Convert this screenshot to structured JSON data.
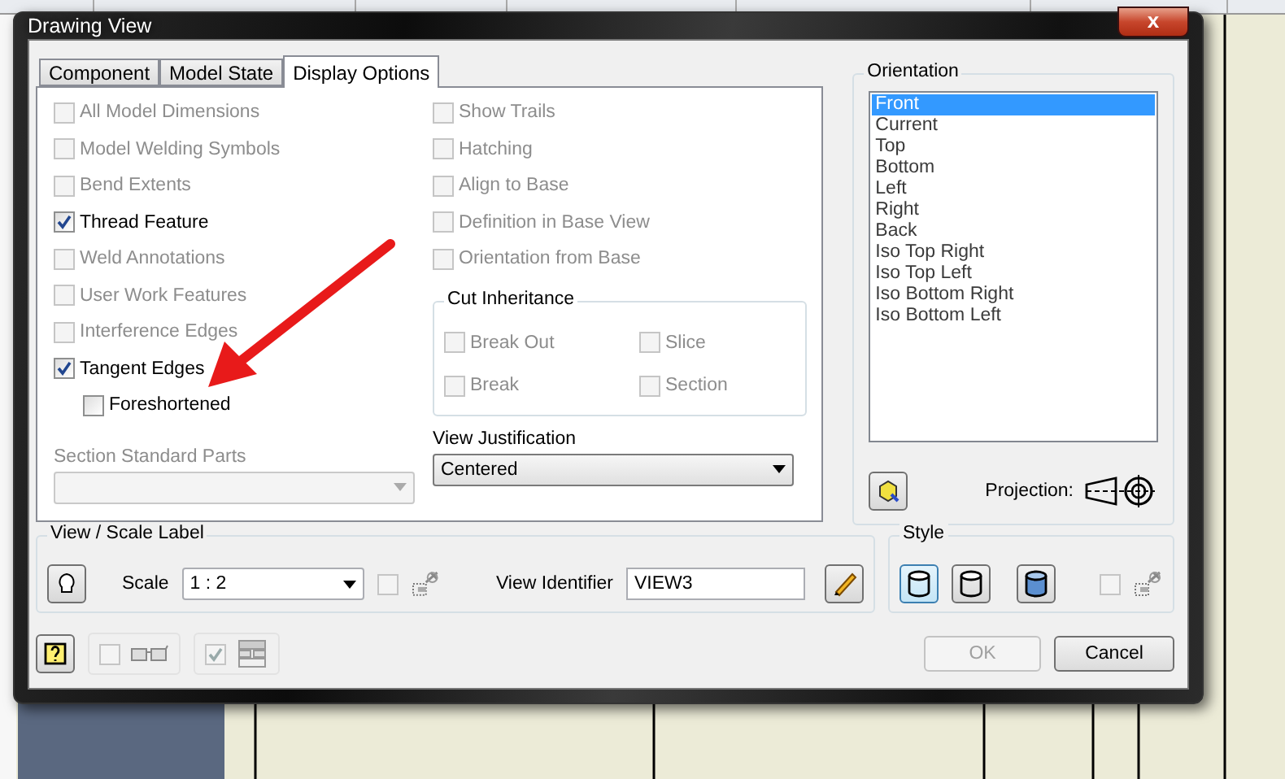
{
  "window": {
    "title": "Drawing View",
    "close": "x"
  },
  "tabs": [
    {
      "label": "Component",
      "selected": false
    },
    {
      "label": "Model State",
      "selected": false
    },
    {
      "label": "Display Options",
      "selected": true
    }
  ],
  "left_options": [
    {
      "label": "All Model Dimensions",
      "checked": false,
      "disabled": true,
      "kind": "option"
    },
    {
      "label": "Model Welding Symbols",
      "checked": false,
      "disabled": true,
      "kind": "option"
    },
    {
      "label": "Bend Extents",
      "checked": false,
      "disabled": true,
      "kind": "option"
    },
    {
      "label": "Thread Feature",
      "checked": true,
      "disabled": false,
      "kind": "option"
    },
    {
      "label": "Weld Annotations",
      "checked": false,
      "disabled": true,
      "kind": "option"
    },
    {
      "label": "User Work Features",
      "checked": false,
      "disabled": true,
      "kind": "option"
    },
    {
      "label": "Interference Edges",
      "checked": false,
      "disabled": true,
      "kind": "option"
    },
    {
      "label": "Tangent Edges",
      "checked": true,
      "disabled": false,
      "kind": "option"
    },
    {
      "label": "Foreshortened",
      "checked": false,
      "disabled": false,
      "kind": "sub"
    }
  ],
  "right_options": [
    {
      "label": "Show Trails",
      "checked": false,
      "disabled": true
    },
    {
      "label": "Hatching",
      "checked": false,
      "disabled": true
    },
    {
      "label": "Align to Base",
      "checked": false,
      "disabled": true
    },
    {
      "label": "Definition in Base View",
      "checked": false,
      "disabled": true
    },
    {
      "label": "Orientation from Base",
      "checked": false,
      "disabled": true
    }
  ],
  "cut_inheritance": {
    "title": "Cut Inheritance",
    "options": [
      {
        "label": "Break Out",
        "checked": false,
        "disabled": true
      },
      {
        "label": "Slice",
        "checked": false,
        "disabled": true
      },
      {
        "label": "Break",
        "checked": false,
        "disabled": true
      },
      {
        "label": "Section",
        "checked": false,
        "disabled": true
      }
    ]
  },
  "section_standard_parts": {
    "label": "Section Standard Parts",
    "disabled": true
  },
  "view_justification": {
    "label": "View Justification",
    "value": "Centered",
    "disabled": false
  },
  "orientation": {
    "title": "Orientation",
    "items": [
      {
        "label": "Front",
        "selected": true
      },
      {
        "label": "Current",
        "selected": false
      },
      {
        "label": "Top",
        "selected": false
      },
      {
        "label": "Bottom",
        "selected": false
      },
      {
        "label": "Left",
        "selected": false
      },
      {
        "label": "Right",
        "selected": false
      },
      {
        "label": "Back",
        "selected": false
      },
      {
        "label": "Iso Top Right",
        "selected": false
      },
      {
        "label": "Iso Top Left",
        "selected": false
      },
      {
        "label": "Iso Bottom Right",
        "selected": false
      },
      {
        "label": "Iso Bottom Left",
        "selected": false
      }
    ],
    "projection_label": "Projection:"
  },
  "view_scale_label": {
    "title": "View / Scale Label",
    "scale_label": "Scale",
    "scale_value": "1 : 2",
    "scale_link_checked": false,
    "identifier_label": "View Identifier",
    "identifier_value": "VIEW3"
  },
  "style": {
    "title": "Style",
    "modes": [
      {
        "selected": true
      },
      {
        "selected": false
      },
      {
        "selected": false
      }
    ],
    "link_checked": false
  },
  "footer": {
    "toggle_1_checked": false,
    "toggle_2_checked": true
  },
  "buttons": [
    {
      "label": "OK",
      "disabled": true
    },
    {
      "label": "Cancel",
      "disabled": false
    }
  ]
}
